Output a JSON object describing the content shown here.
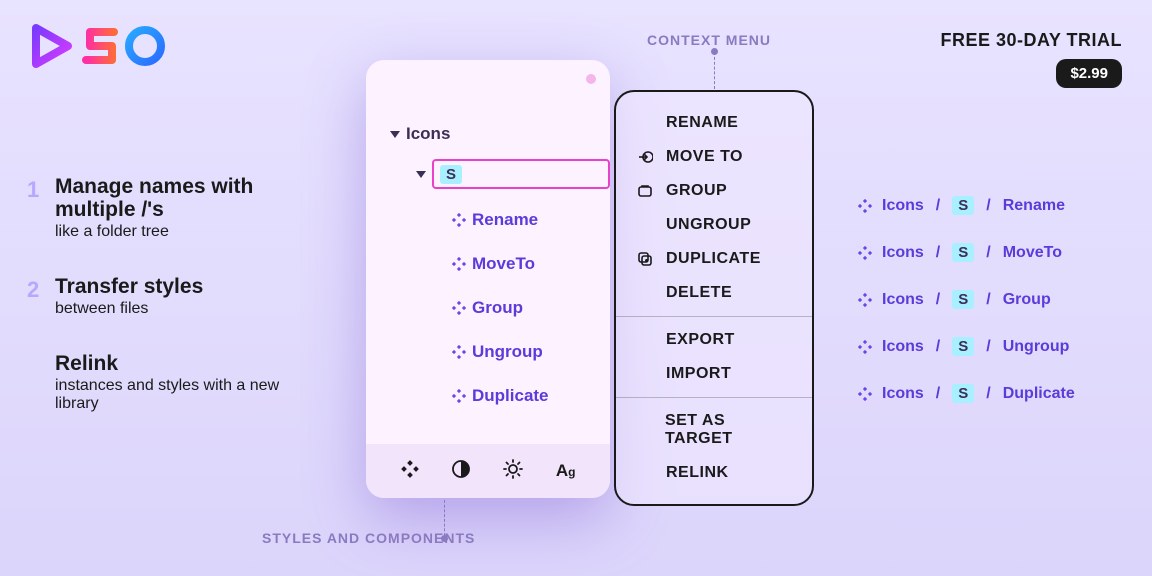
{
  "topright": {
    "trial": "FREE 30-DAY TRIAL",
    "price": "$2.99"
  },
  "features": [
    {
      "num": "1",
      "title": "Manage names with multiple /'s",
      "sub": "like a folder tree"
    },
    {
      "num": "2",
      "title": "Transfer styles",
      "sub": "between files"
    },
    {
      "num": "",
      "title": "Relink",
      "sub": "instances and styles with a new library"
    }
  ],
  "panel": {
    "root": "Icons",
    "selected_chip": "S",
    "children": [
      "Rename",
      "MoveTo",
      "Group",
      "Ungroup",
      "Duplicate"
    ]
  },
  "context_menu": {
    "sections": [
      [
        {
          "icon": "",
          "label": "RENAME"
        },
        {
          "icon": "move-to",
          "label": "MOVE TO"
        },
        {
          "icon": "group",
          "label": "GROUP"
        },
        {
          "icon": "",
          "label": "UNGROUP"
        },
        {
          "icon": "duplicate",
          "label": "DUPLICATE"
        },
        {
          "icon": "",
          "label": "DELETE"
        }
      ],
      [
        {
          "icon": "",
          "label": "EXPORT"
        },
        {
          "icon": "",
          "label": "IMPORT"
        }
      ],
      [
        {
          "icon": "",
          "label": "SET AS TARGET"
        },
        {
          "icon": "",
          "label": "RELINK"
        }
      ]
    ]
  },
  "annotations": {
    "context_menu": "CONTEXT MENU",
    "styles_components": "STYLES AND COMPONENTS"
  },
  "paths": {
    "prefix": "Icons",
    "chip": "S",
    "items": [
      "Rename",
      "MoveTo",
      "Group",
      "Ungroup",
      "Duplicate"
    ]
  }
}
